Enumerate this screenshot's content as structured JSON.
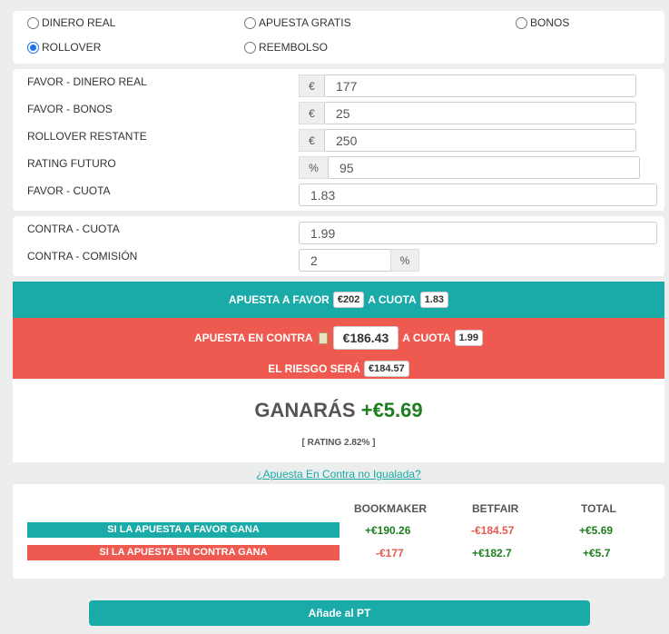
{
  "modes": {
    "dinero_real": "DINERO REAL",
    "apuesta_gratis": "APUESTA GRATIS",
    "bonos": "BONOS",
    "rollover": "ROLLOVER",
    "reembolso": "REEMBOLSO",
    "selected": "ROLLOVER"
  },
  "favor": {
    "dinero_real_label": "FAVOR - DINERO REAL",
    "dinero_real_value": "177",
    "bonos_label": "FAVOR - BONOS",
    "bonos_value": "25",
    "rollover_label": "ROLLOVER RESTANTE",
    "rollover_value": "250",
    "rating_label": "RATING FUTURO",
    "rating_value": "95",
    "cuota_label": "FAVOR - CUOTA",
    "cuota_value": "1.83",
    "currency_addon": "€",
    "percent_addon": "%"
  },
  "contra": {
    "cuota_label": "CONTRA - CUOTA",
    "cuota_value": "1.99",
    "comision_label": "CONTRA - COMISIÓN",
    "comision_value": "2",
    "percent_addon": "%"
  },
  "result": {
    "favor_text": "APUESTA A FAVOR",
    "favor_amount": "€202",
    "a_cuota": "A CUOTA",
    "favor_cuota": "1.83",
    "contra_text": "APUESTA EN CONTRA",
    "contra_amount": "€186.43",
    "contra_cuota": "1.99",
    "riesgo_text": "EL RIESGO SERÁ",
    "riesgo_amount": "€184.57",
    "ganaras_label": "GANARÁS",
    "ganaras_value": "+€5.69",
    "rating_text": "[ RATING 2.82% ]",
    "link_text": "¿Apuesta En Contra no Igualada?",
    "colors": {
      "teal": "#1aaba8",
      "red": "#ef5a50",
      "green": "#1e7e1e"
    }
  },
  "summary": {
    "headers": [
      "BOOKMAKER",
      "BETFAIR",
      "TOTAL"
    ],
    "rows": [
      {
        "label": "SI LA APUESTA A FAVOR GANA",
        "bookmaker": "+€190.26",
        "betfair": "-€184.57",
        "total": "+€5.69"
      },
      {
        "label": "SI LA APUESTA EN CONTRA GANA",
        "bookmaker": "-€177",
        "betfair": "+€182.7",
        "total": "+€5.7"
      }
    ]
  },
  "add_button": "Añade al PT"
}
